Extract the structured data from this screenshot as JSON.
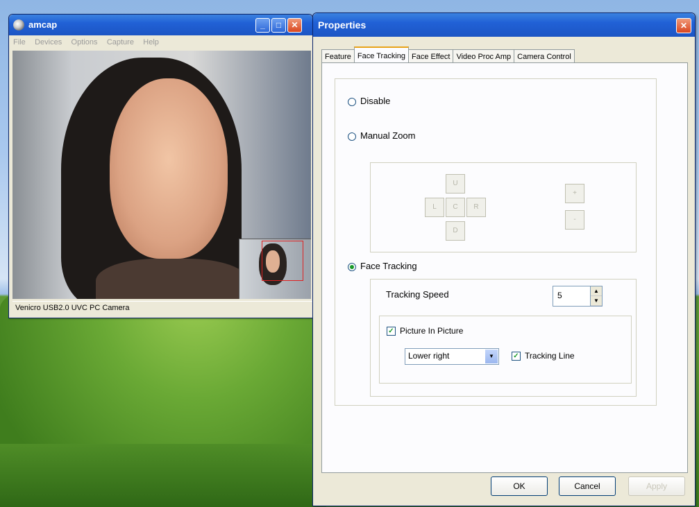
{
  "amcap": {
    "title": "amcap",
    "menu": [
      "File",
      "Devices",
      "Options",
      "Capture",
      "Help"
    ],
    "status": "Venicro USB2.0 UVC PC Camera"
  },
  "props": {
    "title": "Properties",
    "tabs": [
      "Feature",
      "Face Tracking",
      "Face Effect",
      "Video Proc Amp",
      "Camera Control"
    ],
    "radios": {
      "disable": "Disable",
      "manual_zoom": "Manual Zoom",
      "face_tracking": "Face Tracking"
    },
    "zoom_buttons": {
      "up": "U",
      "left": "L",
      "center": "C",
      "right": "R",
      "down": "D",
      "plus": "+",
      "minus": "-"
    },
    "tracking_speed": {
      "label": "Tracking Speed",
      "value": "5"
    },
    "picture_in_picture": {
      "label": "Picture In Picture",
      "checked": true
    },
    "position": {
      "selected": "Lower right"
    },
    "tracking_line": {
      "label": "Tracking Line",
      "checked": true
    },
    "buttons": {
      "ok": "OK",
      "cancel": "Cancel",
      "apply": "Apply"
    }
  }
}
